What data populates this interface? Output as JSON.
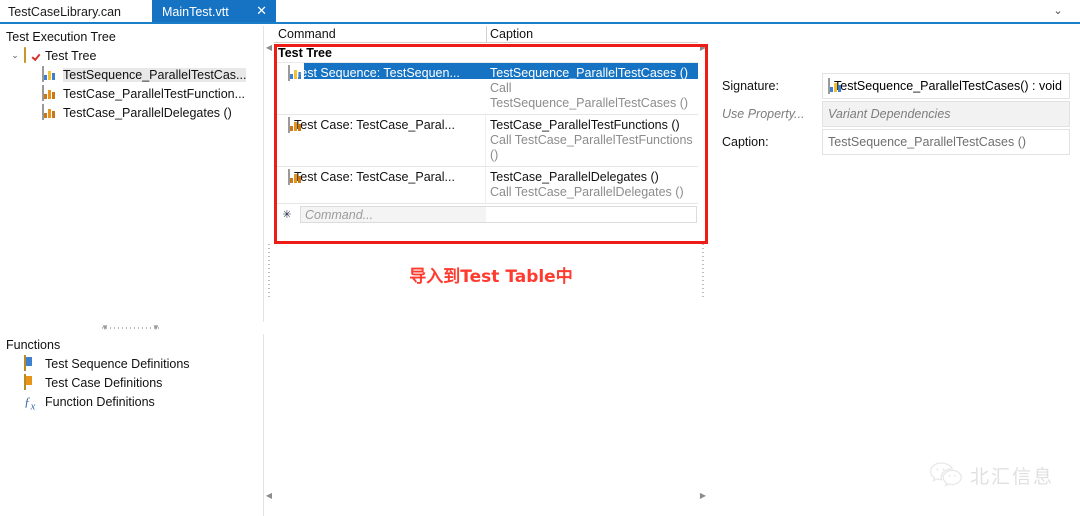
{
  "tabs": {
    "inactive_label": "TestCaseLibrary.can",
    "active_label": "MainTest.vtt",
    "close_glyph": "✕",
    "overflow_glyph": "⌄"
  },
  "left_panel": {
    "title": "Test Execution Tree",
    "root": {
      "label": "Test Tree",
      "twist_glyph": "⌄"
    },
    "items": [
      {
        "label": "TestSequence_ParallelTestCas...",
        "icon": "test-sequence-icon",
        "selected": true
      },
      {
        "label": "TestCase_ParallelTestFunction...",
        "icon": "test-case-icon",
        "selected": false
      },
      {
        "label": "TestCase_ParallelDelegates ()",
        "icon": "test-case-icon",
        "selected": false
      }
    ]
  },
  "functions_panel": {
    "title": "Functions",
    "items": [
      {
        "label": "Test Sequence Definitions",
        "icon": "test-sequence-definitions-icon"
      },
      {
        "label": "Test Case Definitions",
        "icon": "test-case-definitions-icon"
      },
      {
        "label": "Function Definitions",
        "icon": "function-definitions-icon"
      }
    ]
  },
  "center_table": {
    "columns": [
      "Command",
      "Caption"
    ],
    "group_row": "Test Tree",
    "rows": [
      {
        "command": "Test Sequence: TestSequen...",
        "caption_primary": "TestSequence_ParallelTestCases ()",
        "caption_secondary": "Call TestSequence_ParallelTestCases ()",
        "icon": "test-sequence-icon",
        "selected": true
      },
      {
        "command": "Test Case: TestCase_Paral...",
        "caption_primary": "TestCase_ParallelTestFunctions ()",
        "caption_secondary": "Call TestCase_ParallelTestFunctions ()",
        "icon": "test-case-icon",
        "selected": false
      },
      {
        "command": "Test Case: TestCase_Paral...",
        "caption_primary": "TestCase_ParallelDelegates ()",
        "caption_secondary": "Call TestCase_ParallelDelegates ()",
        "icon": "test-case-icon",
        "selected": false
      }
    ],
    "new_row": {
      "star_glyph": "✳",
      "placeholder": "Command..."
    }
  },
  "annotation": {
    "text": "导入到Test Table中",
    "color": "#ff3b30"
  },
  "properties_panel": {
    "rows": [
      {
        "key": "Signature:",
        "value": "TestSequence_ParallelTestCases() : void",
        "icon": "test-sequence-icon",
        "style": "normal"
      },
      {
        "key": "Use Property...",
        "value": "Variant Dependencies",
        "icon": "",
        "style": "muted"
      },
      {
        "key": "Caption:",
        "value": "TestSequence_ParallelTestCases ()",
        "icon": "",
        "style": "caption"
      }
    ]
  },
  "watermark": {
    "text": "北汇信息",
    "icon": "wechat-icon"
  },
  "colors": {
    "accent": "#1673c4",
    "selection": "#1673c4",
    "annotation_red": "#ff3b30",
    "highlight_box": "#ee1c16"
  }
}
